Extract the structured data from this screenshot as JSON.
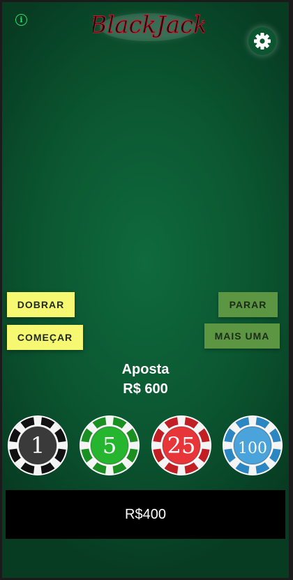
{
  "header": {
    "logo_text": "BlackJack",
    "info_icon": "info-icon",
    "settings_icon": "gear-icon"
  },
  "actions": {
    "double_label": "DOBRAR",
    "start_label": "COMEÇAR",
    "stand_label": "PARAR",
    "hit_label": "MAIS UMA"
  },
  "bet": {
    "label": "Aposta",
    "value": "R$ 600"
  },
  "chips": [
    {
      "label": "1",
      "color": "#3a3a3a",
      "rim": "#111111"
    },
    {
      "label": "5",
      "color": "#25b52f",
      "rim": "#1a8f22"
    },
    {
      "label": "25",
      "color": "#e7353a",
      "rim": "#c21f24"
    },
    {
      "label": "100",
      "color": "#4ba3dc",
      "rim": "#2b86c2"
    }
  ],
  "balance": {
    "value": "R$400"
  },
  "colors": {
    "felt": "#0b5631",
    "button_yellow": "#f6f871",
    "button_olive": "#5c9643",
    "info_green": "#2fdc6a"
  }
}
